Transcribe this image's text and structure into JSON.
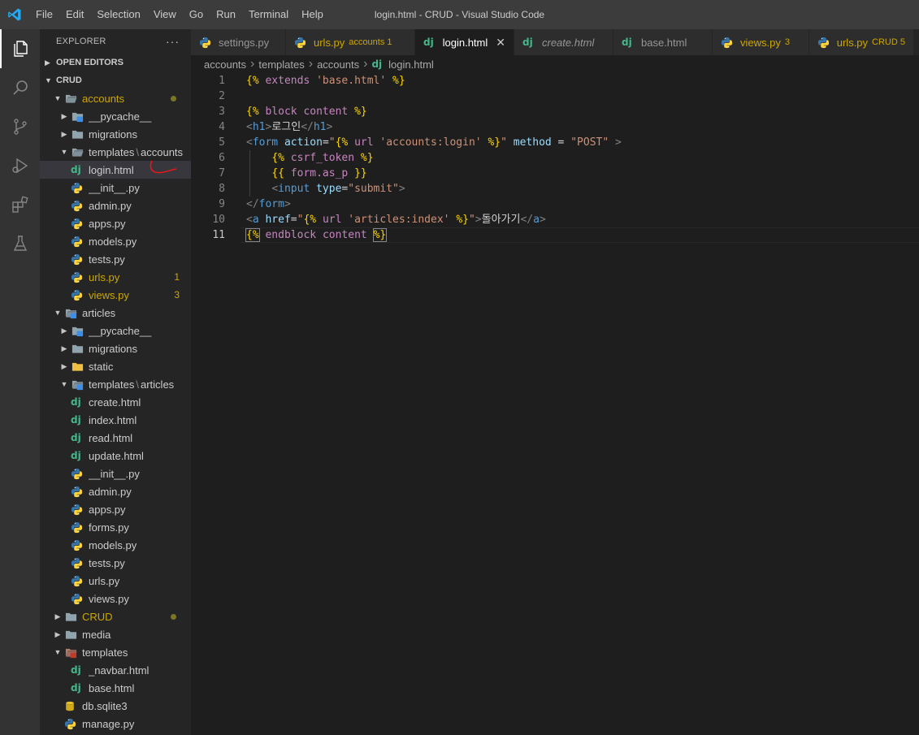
{
  "window": {
    "title": "login.html - CRUD - Visual Studio Code",
    "menu": [
      "File",
      "Edit",
      "Selection",
      "View",
      "Go",
      "Run",
      "Terminal",
      "Help"
    ]
  },
  "sidebar": {
    "title": "EXPLORER",
    "more": "···",
    "open_editors": "OPEN EDITORS",
    "root": "CRUD",
    "tree": [
      {
        "label": "accounts",
        "type": "folder-open",
        "depth": 1,
        "color": "yellow",
        "dot": true
      },
      {
        "label": "__pycache__",
        "type": "folder-blue",
        "depth": 2
      },
      {
        "label": "migrations",
        "type": "folder",
        "depth": 2
      },
      {
        "label_a": "templates",
        "label_b": "accounts",
        "type": "folder-open-grey",
        "depth": 2
      },
      {
        "label": "login.html",
        "type": "dj",
        "depth": 3,
        "selected": true
      },
      {
        "label": "__init__.py",
        "type": "py",
        "depth": 2
      },
      {
        "label": "admin.py",
        "type": "py",
        "depth": 2
      },
      {
        "label": "apps.py",
        "type": "py",
        "depth": 2
      },
      {
        "label": "models.py",
        "type": "py",
        "depth": 2
      },
      {
        "label": "tests.py",
        "type": "py",
        "depth": 2
      },
      {
        "label": "urls.py",
        "type": "py",
        "depth": 2,
        "color": "yellow",
        "badge": "1"
      },
      {
        "label": "views.py",
        "type": "py",
        "depth": 2,
        "color": "yellow",
        "badge": "3"
      },
      {
        "label": "articles",
        "type": "folder-open-blue",
        "depth": 1
      },
      {
        "label": "__pycache__",
        "type": "folder-blue",
        "depth": 2
      },
      {
        "label": "migrations",
        "type": "folder",
        "depth": 2
      },
      {
        "label": "static",
        "type": "folder-yellow",
        "depth": 2
      },
      {
        "label_a": "templates",
        "label_b": "articles",
        "type": "folder-open-blue",
        "depth": 2
      },
      {
        "label": "create.html",
        "type": "dj",
        "depth": 3
      },
      {
        "label": "index.html",
        "type": "dj",
        "depth": 3
      },
      {
        "label": "read.html",
        "type": "dj",
        "depth": 3
      },
      {
        "label": "update.html",
        "type": "dj",
        "depth": 3
      },
      {
        "label": "__init__.py",
        "type": "py",
        "depth": 2
      },
      {
        "label": "admin.py",
        "type": "py",
        "depth": 2
      },
      {
        "label": "apps.py",
        "type": "py",
        "depth": 2
      },
      {
        "label": "forms.py",
        "type": "py",
        "depth": 2
      },
      {
        "label": "models.py",
        "type": "py",
        "depth": 2
      },
      {
        "label": "tests.py",
        "type": "py",
        "depth": 2
      },
      {
        "label": "urls.py",
        "type": "py",
        "depth": 2
      },
      {
        "label": "views.py",
        "type": "py",
        "depth": 2
      },
      {
        "label": "CRUD",
        "type": "folder",
        "depth": 1,
        "color": "yellow",
        "dot": true,
        "collapsed": true
      },
      {
        "label": "media",
        "type": "folder",
        "depth": 1,
        "collapsed": true
      },
      {
        "label": "templates",
        "type": "folder-open-brown",
        "depth": 1
      },
      {
        "label": "_navbar.html",
        "type": "dj",
        "depth": 2
      },
      {
        "label": "base.html",
        "type": "dj",
        "depth": 2
      },
      {
        "label": "db.sqlite3",
        "type": "db",
        "depth": 1
      },
      {
        "label": "manage.py",
        "type": "py",
        "depth": 1
      }
    ]
  },
  "tabs": [
    {
      "label": "settings.py",
      "icon": "py",
      "desc": "",
      "state": "normal"
    },
    {
      "label": "urls.py",
      "icon": "py",
      "desc": "accounts 1",
      "state": "warn"
    },
    {
      "label": "login.html",
      "icon": "dj",
      "desc": "",
      "state": "active",
      "close": "✕"
    },
    {
      "label": "create.html",
      "icon": "dj",
      "desc": "",
      "state": "italic"
    },
    {
      "label": "base.html",
      "icon": "dj",
      "desc": "",
      "state": "normal"
    },
    {
      "label": "views.py",
      "icon": "py",
      "desc": "3",
      "state": "warn"
    },
    {
      "label": "urls.py",
      "icon": "py",
      "desc": "CRUD 5",
      "state": "warn"
    }
  ],
  "breadcrumb": [
    "accounts",
    "templates",
    "accounts",
    "login.html"
  ],
  "editor": {
    "current_line": 11,
    "lines": [
      [
        [
          "tpl",
          "{%"
        ],
        [
          "text",
          " "
        ],
        [
          "kw",
          "extends"
        ],
        [
          "text",
          " "
        ],
        [
          "str",
          "'base.html'"
        ],
        [
          "text",
          " "
        ],
        [
          "tpl",
          "%}"
        ]
      ],
      [],
      [
        [
          "tpl",
          "{%"
        ],
        [
          "text",
          " "
        ],
        [
          "kw",
          "block"
        ],
        [
          "text",
          " "
        ],
        [
          "kw",
          "content"
        ],
        [
          "text",
          " "
        ],
        [
          "tpl",
          "%}"
        ]
      ],
      [
        [
          "tpunc",
          "<"
        ],
        [
          "tag",
          "h1"
        ],
        [
          "tpunc",
          ">"
        ],
        [
          "text",
          "로그인"
        ],
        [
          "tpunc",
          "</"
        ],
        [
          "tag",
          "h1"
        ],
        [
          "tpunc",
          ">"
        ]
      ],
      [
        [
          "tpunc",
          "<"
        ],
        [
          "tag",
          "form"
        ],
        [
          "text",
          " "
        ],
        [
          "attr",
          "action"
        ],
        [
          "text",
          "="
        ],
        [
          "str",
          "\""
        ],
        [
          "tpl",
          "{%"
        ],
        [
          "text",
          " "
        ],
        [
          "kw",
          "url"
        ],
        [
          "text",
          " "
        ],
        [
          "str",
          "'accounts:login'"
        ],
        [
          "text",
          " "
        ],
        [
          "tpl",
          "%}"
        ],
        [
          "str",
          "\""
        ],
        [
          "text",
          " "
        ],
        [
          "attr",
          "method"
        ],
        [
          "text",
          " = "
        ],
        [
          "str",
          "\"POST\""
        ],
        [
          "text",
          " "
        ],
        [
          "tpunc",
          ">"
        ]
      ],
      [
        [
          "text",
          "    "
        ],
        [
          "tpl",
          "{%"
        ],
        [
          "text",
          " "
        ],
        [
          "kw",
          "csrf_token"
        ],
        [
          "text",
          " "
        ],
        [
          "tpl",
          "%}"
        ]
      ],
      [
        [
          "text",
          "    "
        ],
        [
          "tpl",
          "{{"
        ],
        [
          "text",
          " "
        ],
        [
          "var",
          "form.as_p"
        ],
        [
          "text",
          " "
        ],
        [
          "tpl",
          "}}"
        ]
      ],
      [
        [
          "text",
          "    "
        ],
        [
          "tpunc",
          "<"
        ],
        [
          "tag",
          "input"
        ],
        [
          "text",
          " "
        ],
        [
          "attr",
          "type"
        ],
        [
          "text",
          "="
        ],
        [
          "str",
          "\"submit\""
        ],
        [
          "tpunc",
          ">"
        ]
      ],
      [
        [
          "tpunc",
          "</"
        ],
        [
          "tag",
          "form"
        ],
        [
          "tpunc",
          ">"
        ]
      ],
      [
        [
          "tpunc",
          "<"
        ],
        [
          "tag",
          "a"
        ],
        [
          "text",
          " "
        ],
        [
          "attr",
          "href"
        ],
        [
          "text",
          "="
        ],
        [
          "str",
          "\""
        ],
        [
          "tpl",
          "{%"
        ],
        [
          "text",
          " "
        ],
        [
          "kw",
          "url"
        ],
        [
          "text",
          " "
        ],
        [
          "str",
          "'articles:index'"
        ],
        [
          "text",
          " "
        ],
        [
          "tpl",
          "%}"
        ],
        [
          "str",
          "\""
        ],
        [
          "tpunc",
          ">"
        ],
        [
          "text",
          "돌아가기"
        ],
        [
          "tpunc",
          "</"
        ],
        [
          "tag",
          "a"
        ],
        [
          "tpunc",
          ">"
        ]
      ],
      [
        [
          "tplh",
          "{%"
        ],
        [
          "text",
          " "
        ],
        [
          "kw",
          "endblock"
        ],
        [
          "text",
          " "
        ],
        [
          "kw",
          "content"
        ],
        [
          "text",
          " "
        ],
        [
          "tplh",
          "%}"
        ]
      ]
    ]
  },
  "colors": {
    "accent_vscode": "#23aaf2",
    "title_bar": "#3c3c3c",
    "activity_bar": "#333333",
    "sidebar": "#252526",
    "editor": "#1e1e1e",
    "warning": "#cca700",
    "django": "#44b78b",
    "python_blue": "#3776ab",
    "python_yellow": "#ffd43b"
  },
  "activity_icons": [
    "files-icon",
    "search-icon",
    "source-control-icon",
    "run-debug-icon",
    "extensions-icon",
    "testing-icon"
  ]
}
